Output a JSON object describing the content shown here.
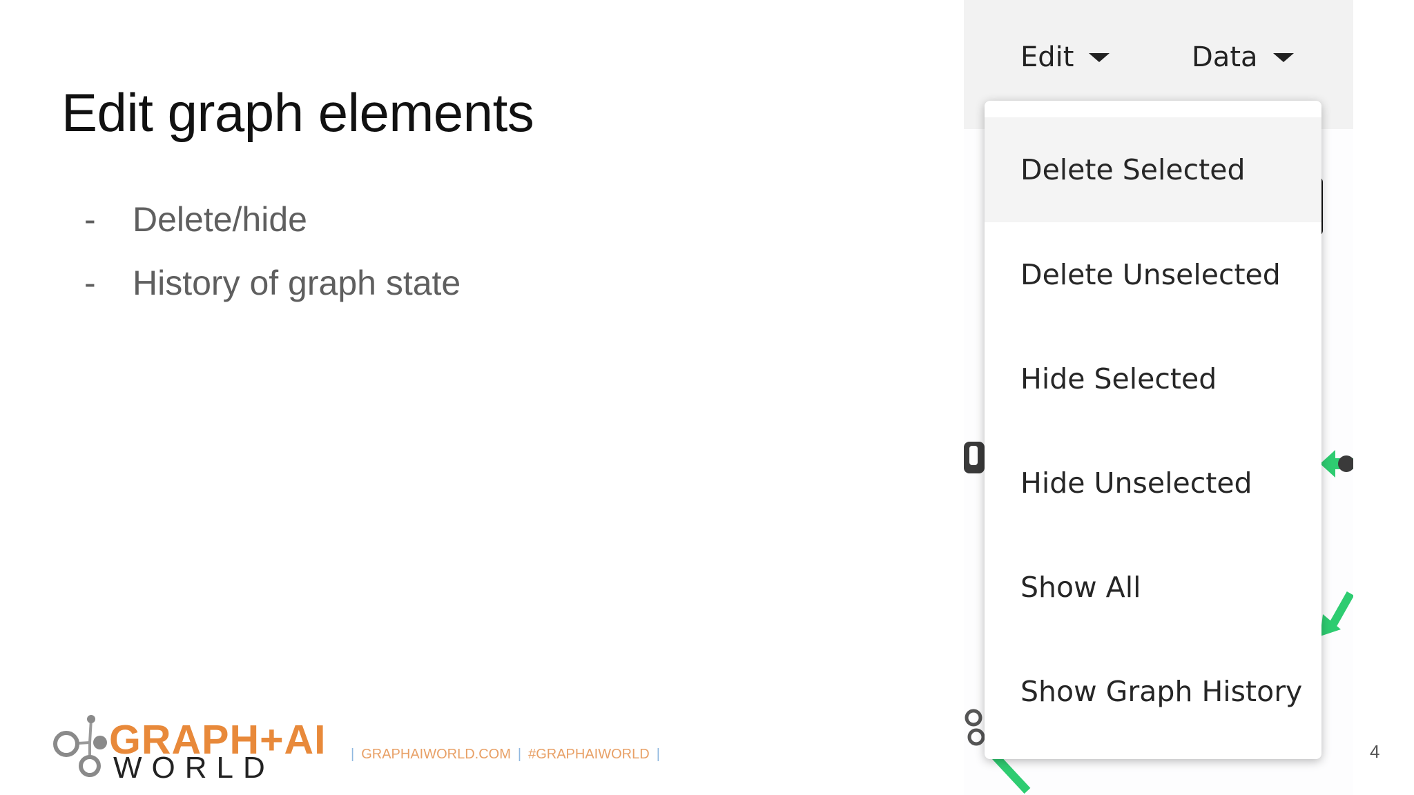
{
  "slide": {
    "title": "Edit graph elements",
    "bullets": [
      {
        "marker": "-",
        "text": "Delete/hide"
      },
      {
        "marker": "-",
        "text": "History of graph state"
      }
    ],
    "page_number": "4"
  },
  "app": {
    "menubar": {
      "edit_label": "Edit",
      "data_label": "Data"
    },
    "dropdown": {
      "items": [
        {
          "label": "Delete Selected"
        },
        {
          "label": "Delete Unselected"
        },
        {
          "label": "Hide Selected"
        },
        {
          "label": "Hide Unselected"
        },
        {
          "label": "Show All"
        },
        {
          "label": "Show Graph History"
        }
      ],
      "highlighted_item": "Delete Selected"
    },
    "accent_green": "#2ecc71"
  },
  "footer": {
    "logo_top": "GRAPH+AI",
    "logo_bottom": "WORLD",
    "site": "GRAPHAIWORLD.COM",
    "hashtag": "#GRAPHAIWORLD",
    "separator": "|",
    "brand_orange": "#e8893a"
  }
}
